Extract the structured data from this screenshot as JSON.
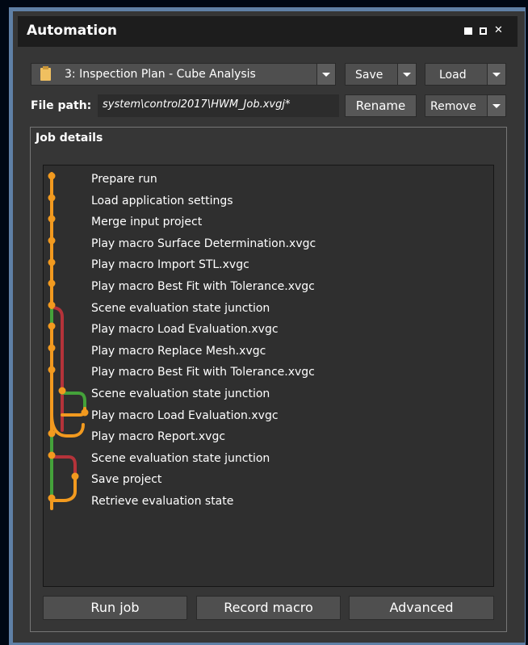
{
  "window": {
    "title": "Automation"
  },
  "toolbar": {
    "plan_selected": "3: Inspection Plan - Cube Analysis",
    "save_label": "Save",
    "load_label": "Load",
    "file_path_label": "File path:",
    "file_path_value": "system\\control2017\\HWM_Job.xvgj*",
    "rename_label": "Rename",
    "remove_label": "Remove"
  },
  "job_details": {
    "title": "Job details",
    "steps": [
      "Prepare run",
      "Load application settings",
      "Merge input project",
      "Play macro Surface Determination.xvgc",
      "Play macro Import STL.xvgc",
      "Play macro Best Fit with Tolerance.xvgc",
      "Scene evaluation state junction",
      "Play macro Load Evaluation.xvgc",
      "Play macro Replace Mesh.xvgc",
      "Play macro Best Fit with Tolerance.xvgc",
      "Scene evaluation state junction",
      "Play macro Load Evaluation.xvgc",
      "Play macro Report.xvgc",
      "Scene evaluation state junction",
      "Save project",
      "Retrieve evaluation state"
    ]
  },
  "actions": {
    "run_job": "Run job",
    "record_macro": "Record macro",
    "advanced": "Advanced"
  },
  "colors": {
    "orange": "#f29a1f",
    "green": "#44a23a",
    "red": "#b5333a"
  }
}
